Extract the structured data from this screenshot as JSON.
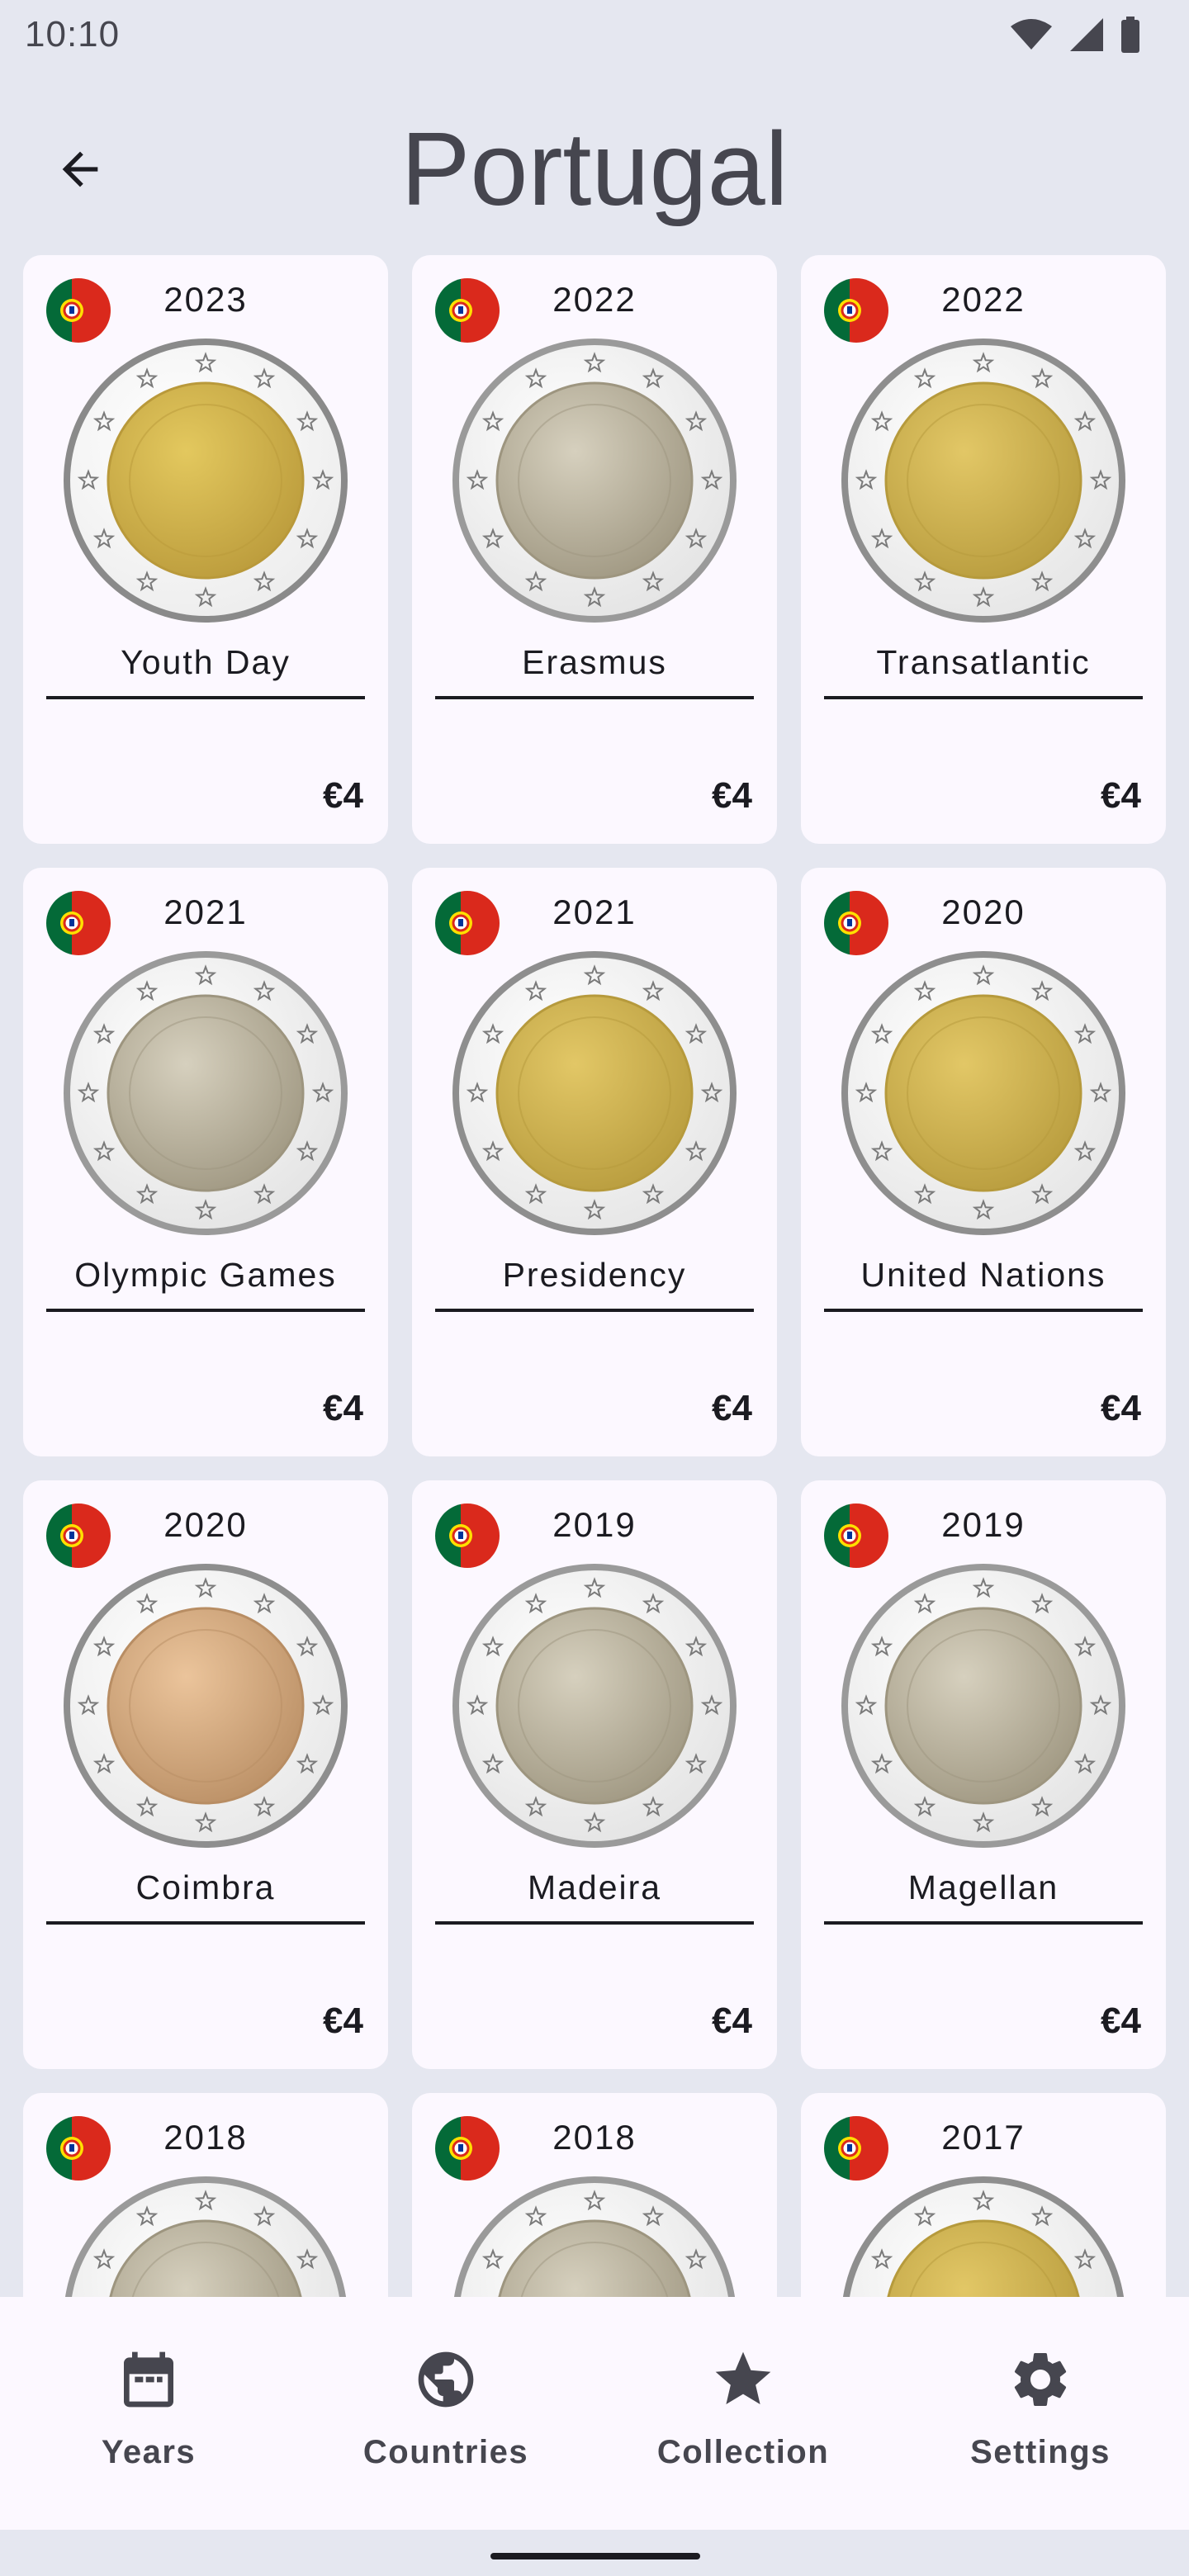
{
  "status_bar": {
    "time": "10:10"
  },
  "header": {
    "title": "Portugal"
  },
  "coins": [
    {
      "year": "2023",
      "name": "Youth Day",
      "price": "€4",
      "style": "gold"
    },
    {
      "year": "2022",
      "name": "Erasmus",
      "price": "€4",
      "style": "silver"
    },
    {
      "year": "2022",
      "name": "Transatlantic",
      "price": "€4",
      "style": "bimetal"
    },
    {
      "year": "2021",
      "name": "Olympic Games",
      "price": "€4",
      "style": "silver"
    },
    {
      "year": "2021",
      "name": "Presidency",
      "price": "€4",
      "style": "bimetal"
    },
    {
      "year": "2020",
      "name": "United Nations",
      "price": "€4",
      "style": "bimetal"
    },
    {
      "year": "2020",
      "name": "Coimbra",
      "price": "€4",
      "style": "copper"
    },
    {
      "year": "2019",
      "name": "Madeira",
      "price": "€4",
      "style": "silver"
    },
    {
      "year": "2019",
      "name": "Magellan",
      "price": "€4",
      "style": "silver"
    },
    {
      "year": "2018",
      "name": "",
      "price": "",
      "style": "silver"
    },
    {
      "year": "2018",
      "name": "",
      "price": "",
      "style": "silver"
    },
    {
      "year": "2017",
      "name": "",
      "price": "",
      "style": "bimetal"
    }
  ],
  "bottom_nav": [
    {
      "label": "Years",
      "icon": "calendar-icon"
    },
    {
      "label": "Countries",
      "icon": "globe-icon"
    },
    {
      "label": "Collection",
      "icon": "star-icon"
    },
    {
      "label": "Settings",
      "icon": "gear-icon"
    }
  ],
  "colors": {
    "background": "#e5e7f0",
    "card": "#fcf8ff",
    "text": "#1b1b21",
    "flag_green": "#046a38",
    "flag_red": "#da291c"
  }
}
